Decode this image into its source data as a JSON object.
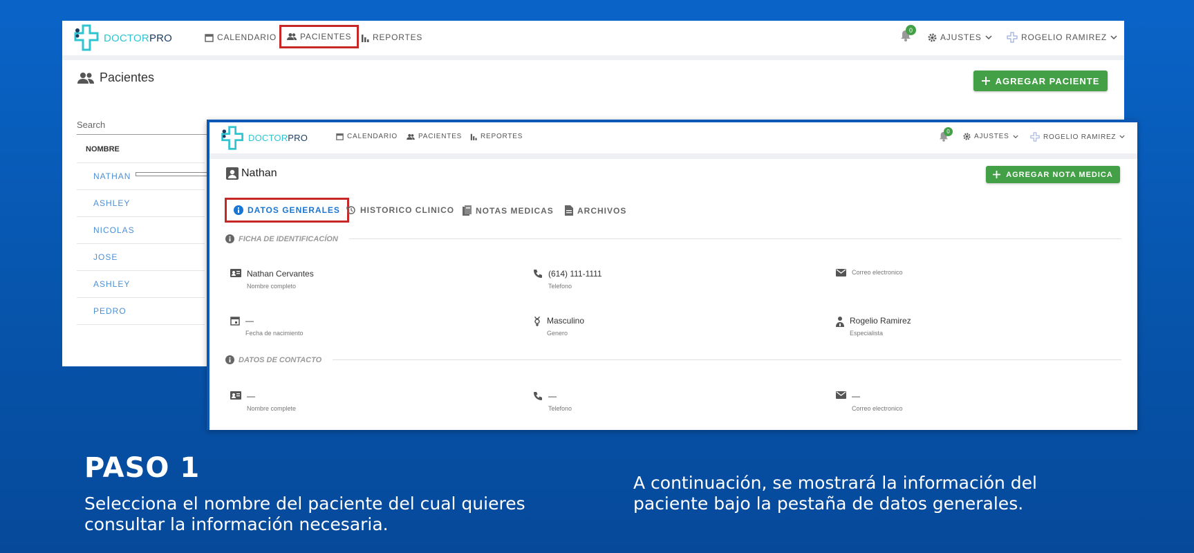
{
  "logo": {
    "part1": "DOCTOR",
    "part2": "PRO"
  },
  "nav": {
    "calendar": "CALENDARIO",
    "patients": "PACIENTES",
    "reports": "REPORTES",
    "notif_count": "0",
    "settings": "AJUSTES",
    "user": "ROGELIO RAMIREZ"
  },
  "back_page": {
    "title": "Pacientes",
    "add_button": "AGREGAR PACIENTE",
    "search_placeholder": "Search",
    "column_header": "NOMBRE",
    "patients": [
      "NATHAN",
      "ASHLEY",
      "NICOLAS",
      "JOSE",
      "ASHLEY",
      "PEDRO"
    ]
  },
  "front_page": {
    "patient_name": "Nathan",
    "add_note_button": "AGREGAR NOTA MEDICA",
    "tabs": [
      "DATOS GENERALES",
      "HISTORICO CLINICO",
      "NOTAS MEDICAS",
      "ARCHIVOS"
    ],
    "section_id": "FICHA DE IDENTIFICACÍON",
    "section_contact": "DATOS DE CONTACTO",
    "id_fields": [
      {
        "value": "Nathan Cervantes",
        "label": "Nombre completo"
      },
      {
        "value": "(614) 111-1111",
        "label": "Telefono"
      },
      {
        "value": "",
        "label": "Correo electronico"
      },
      {
        "value": "—",
        "label": "Fecha de nacimiento"
      },
      {
        "value": "Masculino",
        "label": "Genero"
      },
      {
        "value": "Rogelio Ramirez",
        "label": "Especialista"
      }
    ],
    "contact_fields": [
      {
        "value": "—",
        "label": "Nombre complete"
      },
      {
        "value": "—",
        "label": "Telefono"
      },
      {
        "value": "—",
        "label": "Correo electronico"
      }
    ]
  },
  "instructions": {
    "step_title": "PASO 1",
    "left_text": "Selecciona el nombre del paciente del cual quieres consultar la información necesaria.",
    "right_text": "A continuación, se mostrará la información del paciente bajo la pestaña de datos generales."
  },
  "colors": {
    "accent_green": "#43a047",
    "highlight_red": "#c62828",
    "link_blue": "#4b8fd6",
    "active_tab_blue": "#1976d2"
  }
}
